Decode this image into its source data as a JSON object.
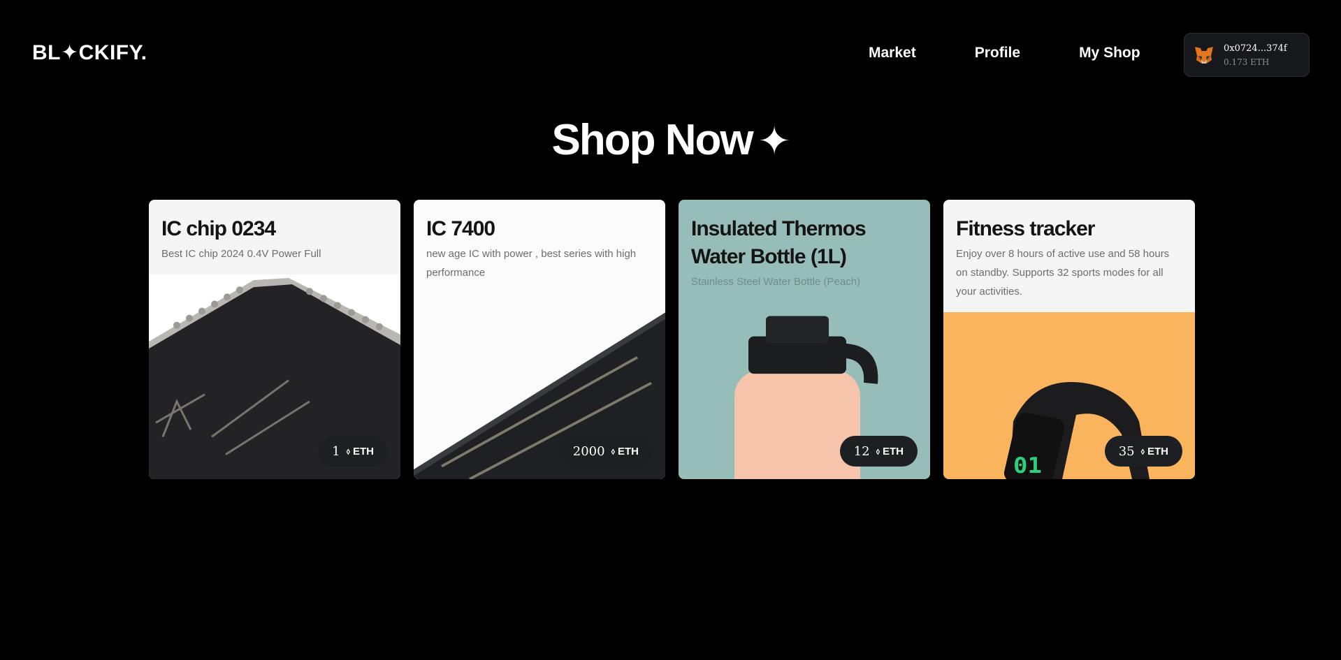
{
  "header": {
    "logo_text": "BL✦CKIFY.",
    "nav": [
      "Market",
      "Profile",
      "My Shop"
    ],
    "wallet": {
      "address": "0x0724...374f",
      "balance": "0.173 ETH",
      "icon": "metamask-fox-icon"
    }
  },
  "main": {
    "heading": "Shop Now",
    "heading_icon": "sparkle-icon",
    "currency": "ETH",
    "products": [
      {
        "title": "IC chip 0234",
        "description": "Best IC chip 2024 0.4V Power Full",
        "price": "1",
        "currency": "ETH",
        "image": "ic-chip-photo"
      },
      {
        "title": "IC 7400",
        "description": "new age IC with power , best series with high performance",
        "price": "2000",
        "currency": "ETH",
        "image": "ic-chip-photo"
      },
      {
        "title": "Insulated Thermos Water Bottle (1L)",
        "description": "Stainless Steel Water Bottle (Peach)",
        "price": "12",
        "currency": "ETH",
        "image": "water-bottle-photo"
      },
      {
        "title": "Fitness tracker",
        "description": "Enjoy over 8 hours of active use and 58 hours on standby. Supports 32 sports modes for all your activities.",
        "price": "35",
        "currency": "ETH",
        "image": "fitness-tracker-photo"
      }
    ]
  },
  "colors": {
    "background": "#000000",
    "price_pill": "#1e1f22",
    "card_bottle_bg": "#97bdb8",
    "card_tracker_img_bg": "#f9b45d"
  }
}
